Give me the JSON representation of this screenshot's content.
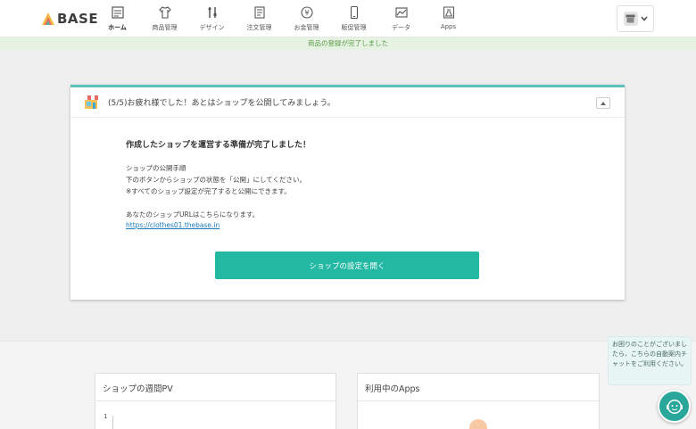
{
  "header": {
    "logo_text": "BASE",
    "nav": [
      {
        "label": "ホーム",
        "icon": "home-icon"
      },
      {
        "label": "商品管理",
        "icon": "shirt-icon"
      },
      {
        "label": "デザイン",
        "icon": "design-tools-icon"
      },
      {
        "label": "注文管理",
        "icon": "order-document-icon"
      },
      {
        "label": "お金管理",
        "icon": "money-icon"
      },
      {
        "label": "販促管理",
        "icon": "phone-icon"
      },
      {
        "label": "データ",
        "icon": "chart-icon"
      },
      {
        "label": "Apps",
        "icon": "flask-icon"
      }
    ],
    "active_nav": "ホーム",
    "account_icon": "shop-store-icon"
  },
  "banner": {
    "text": "商品の登録が完了しました"
  },
  "setup_card": {
    "title": "(5/5)お疲れ様でした！あとはショップを公開してみましょう。",
    "heading": "作成したショップを運営する準備が完了しました！",
    "steps_title": "ショップの公開手順",
    "steps_line1": "下のボタンからショップの状態を「公開」にしてください。",
    "steps_note": "※すべてのショップ設定が完了すると公開にできます。",
    "url_label": "あなたのショップURLはこちらになります。",
    "url": "https://clothes01.thebase.in",
    "button_label": "ショップの設定を開く"
  },
  "panels": {
    "pv_title": "ショップの週間PV",
    "pv_tick": "1",
    "apps_title": "利用中のApps"
  },
  "chat": {
    "bubble_text": "お困りのことがございましたら、こちらの自動案内チャットをご利用ください。"
  },
  "colors": {
    "accent": "#23b8a2",
    "banner_bg": "#e7f3e2",
    "banner_text": "#5b9a4b",
    "link": "#1a7bbd"
  }
}
